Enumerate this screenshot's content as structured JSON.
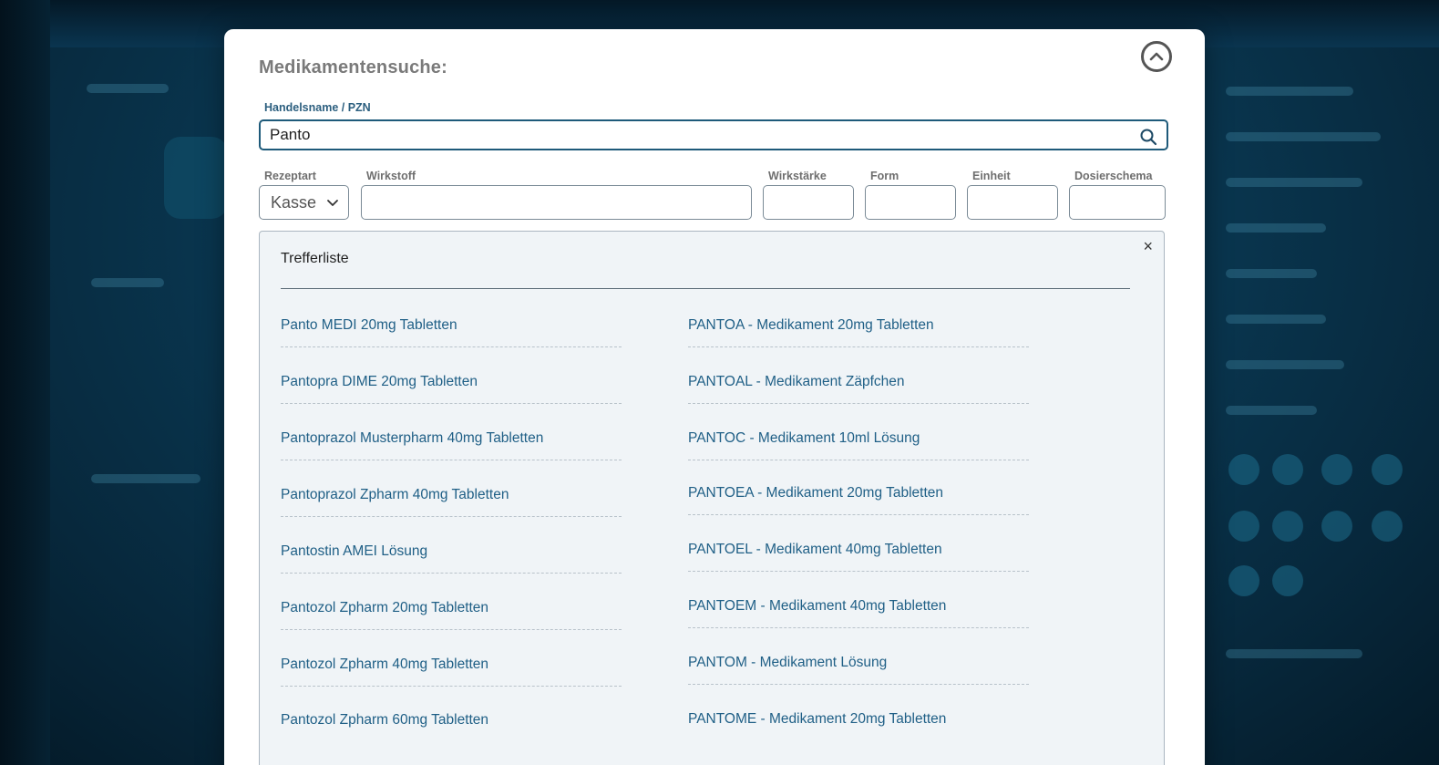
{
  "modal": {
    "title": "Medikamentensuche:"
  },
  "search": {
    "label": "Handelsname / PZN",
    "value": "Panto"
  },
  "fields": {
    "rezeptart_label": "Rezeptart",
    "rezeptart_value": "Kasse",
    "wirkstoff_label": "Wirkstoff",
    "wirkstaerke_label": "Wirkstärke",
    "form_label": "Form",
    "einheit_label": "Einheit",
    "dosierschema_label": "Dosierschema"
  },
  "results": {
    "title": "Trefferliste",
    "close_symbol": "×",
    "left": [
      "Panto MEDI 20mg Tabletten",
      "Pantopra DIME 20mg Tabletten",
      "Pantoprazol Musterpharm 40mg Tabletten",
      "Pantoprazol Zpharm 40mg Tabletten",
      "Pantostin AMEI Lösung",
      "Pantozol Zpharm 20mg Tabletten",
      "Pantozol Zpharm 40mg Tabletten",
      "Pantozol Zpharm 60mg Tabletten"
    ],
    "right": [
      "PANTOA - Medikament 20mg Tabletten",
      "PANTOAL - Medikament Zäpfchen",
      "PANTOC - Medikament 10ml Lösung",
      "PANTOEA - Medikament 20mg Tabletten",
      "PANTOEL - Medikament 40mg Tabletten",
      "PANTOEM - Medikament 40mg Tabletten",
      "PANTOM - Medikament Lösung",
      "PANTOME - Medikament 20mg Tabletten"
    ]
  },
  "icons": {
    "collapse": "chevron-up-circle-icon",
    "search": "search-icon",
    "dropdown": "chevron-down-icon",
    "close": "close-icon"
  },
  "colors": {
    "accent": "#1f5f86",
    "border_active": "#1e5a7a",
    "results_bg": "#f0f4f7"
  }
}
